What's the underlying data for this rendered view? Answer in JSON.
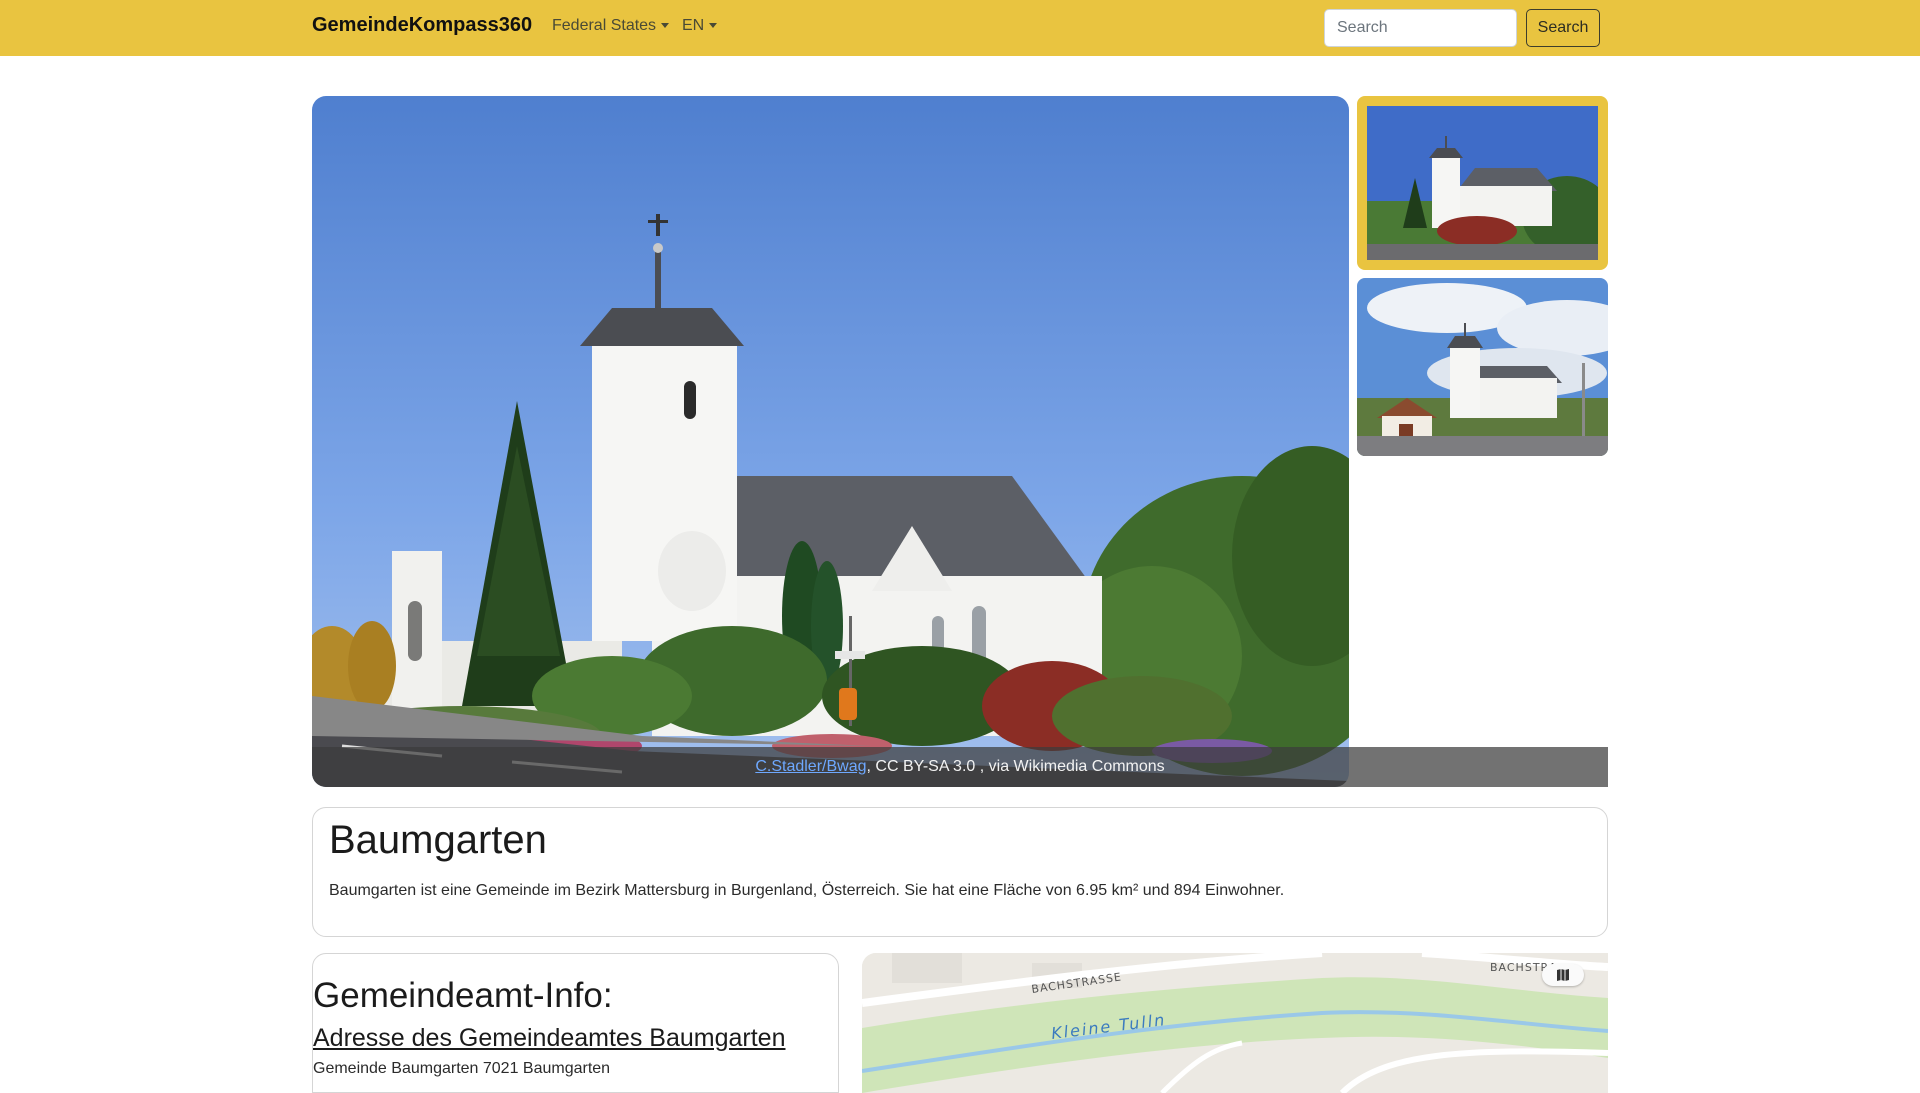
{
  "navbar": {
    "brand": "GemeindeKompass360",
    "federal_states": "Federal States",
    "language": "EN",
    "search_placeholder": "Search",
    "search_button": "Search",
    "background_color": "#e9c440"
  },
  "gallery": {
    "caption_author": "C.Stadler/Bwag",
    "caption_rest": ", CC BY-SA 3.0 , via Wikimedia Commons",
    "selected_thumbnail": 1
  },
  "municipality": {
    "name": "Baumgarten",
    "description": "Baumgarten ist eine Gemeinde im Bezirk Mattersburg in Burgenland, Österreich. Sie hat eine Fläche von 6.95 km² und 894 Einwohner."
  },
  "office": {
    "heading": "Gemeindeamt-Info:",
    "address_title": "Adresse des Gemeindeamtes Baumgarten",
    "address": "Gemeinde Baumgarten 7021 Baumgarten"
  },
  "map": {
    "street_1": "BACHSTRASSE",
    "street_2": "BACHSTRA",
    "river": "Kleine Tulln"
  }
}
